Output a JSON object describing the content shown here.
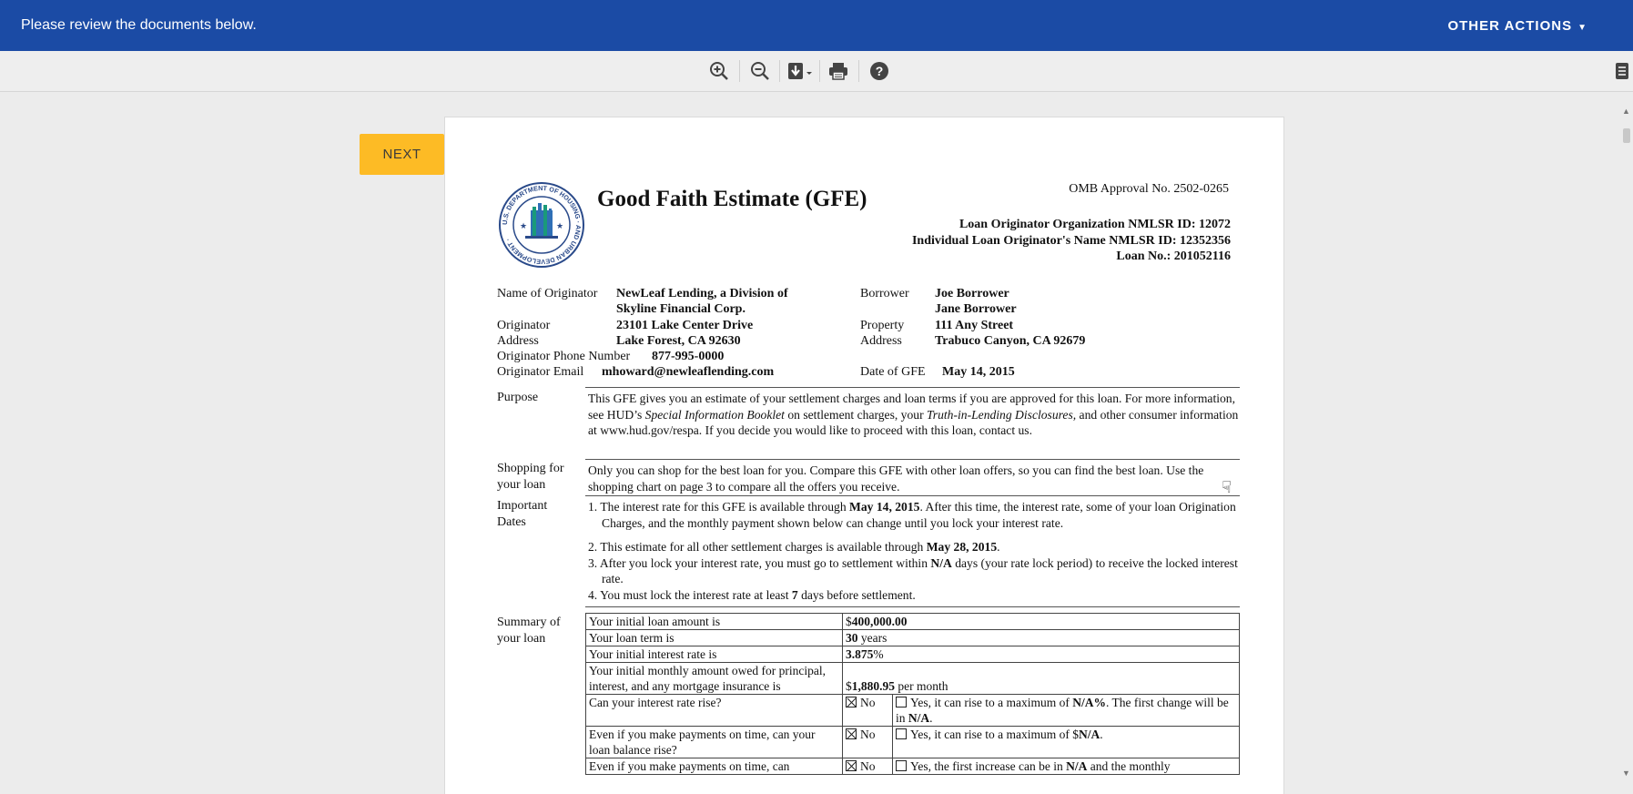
{
  "topbar": {
    "message": "Please review the documents below.",
    "other_actions": "OTHER ACTIONS"
  },
  "toolbar": {
    "icons": [
      "zoom-in-icon",
      "zoom-out-icon",
      "download-icon",
      "print-icon",
      "help-icon",
      "document-panel-icon"
    ]
  },
  "next_button": "NEXT",
  "document": {
    "title": "Good Faith Estimate (GFE)",
    "omb": "OMB Approval No. 2502-0265",
    "org_nmlsr": "Loan Originator Organization NMLSR ID: 12072",
    "ind_nmlsr": "Individual Loan Originator's Name NMLSR ID: 12352356",
    "loan_no": "Loan No.: 201052116",
    "seal_text": "U.S. DEPARTMENT OF HOUSING AND URBAN DEVELOPMENT",
    "labels": {
      "name_of_originator": "Name of Originator",
      "originator": "Originator",
      "address": "Address",
      "phone": "Originator Phone Number",
      "email": "Originator Email",
      "borrower": "Borrower",
      "property": "Property",
      "property_address": "Address",
      "date_of_gfe": "Date of GFE"
    },
    "originator_name_1": "NewLeaf Lending, a Division of",
    "originator_name_2": "Skyline Financial Corp.",
    "originator_address_1": "23101 Lake Center Drive",
    "originator_address_2": "Lake Forest, CA  92630",
    "originator_phone": "877-995-0000",
    "originator_email": "mhoward@newleaflending.com",
    "borrower_1": "Joe Borrower",
    "borrower_2": "Jane Borrower",
    "property_1": "111 Any Street",
    "property_2": "Trabuco Canyon, CA  92679",
    "date_of_gfe": "May 14, 2015",
    "purpose_label": "Purpose",
    "shopping_label_1": "Shopping for",
    "shopping_label_2": "your loan",
    "dates_label_1": "Important",
    "dates_label_2": "Dates",
    "summary_label_1": "Summary of",
    "summary_label_2": "your loan",
    "purpose_a": "This GFE gives you an estimate of your settlement charges and loan terms if you are approved for this loan.  For more information, see HUD’s ",
    "purpose_b": "Special Information Booklet",
    "purpose_c": " on settlement charges, your ",
    "purpose_d": "Truth-in-Lending Disclosures,",
    "purpose_e": " and other consumer information at www.hud.gov/respa.  If you decide you would like to proceed with this loan, contact us.",
    "shopping_text": "Only you can shop for the best loan for you.  Compare this GFE with other loan offers, so you can find the best loan. Use the shopping chart on page 3 to compare all the offers you receive.",
    "date1_a": "1. The interest rate for this GFE is available through ",
    "date1_b": "May 14, 2015",
    "date1_c": ".  After this time, the interest rate, some of your loan Origination Charges, and the monthly payment shown below can change until you lock your interest rate.",
    "date2_a": "2. This estimate for all other settlement charges is available through ",
    "date2_b": "May 28, 2015",
    "date2_c": ".",
    "date3_a": "3. After you lock your interest rate, you must go to settlement within ",
    "date3_b": "N/A",
    "date3_c": " days (your rate lock period) to receive the locked interest rate.",
    "date4_a": "4. You must lock the interest rate at least ",
    "date4_b": "7",
    "date4_c": " days before settlement.",
    "summary": {
      "loan_amount_q": "Your initial loan amount is",
      "loan_amount_cur": "$",
      "loan_amount_v": "400,000.00",
      "term_q": "Your loan term is",
      "term_v": "30",
      "term_unit": " years",
      "rate_q": "Your initial interest rate is",
      "rate_v": "3.875",
      "rate_unit": "%",
      "monthly_q": "Your initial monthly amount owed for principal, interest, and any mortgage insurance is",
      "monthly_cur": "$",
      "monthly_v": "1,880.95",
      "monthly_unit": " per month",
      "rate_rise_q": "Can your interest rate rise?",
      "no": "No",
      "rate_rise_yes_a": "Yes, it can rise to a maximum of ",
      "rate_rise_yes_b": "N/A%",
      "rate_rise_yes_c": ".  The first change will be in ",
      "rate_rise_yes_d": "N/A",
      "rate_rise_yes_e": ".",
      "balance_q": "Even if you make payments on time, can your loan balance rise?",
      "balance_yes_a": "Yes, it can rise to a maximum of $",
      "balance_yes_b": "N/A",
      "balance_yes_c": ".",
      "payment_q": "Even if you make payments on time, can",
      "payment_yes_a": "Yes, the first increase can be in ",
      "payment_yes_b": "N/A",
      "payment_yes_c": " and the monthly"
    }
  }
}
